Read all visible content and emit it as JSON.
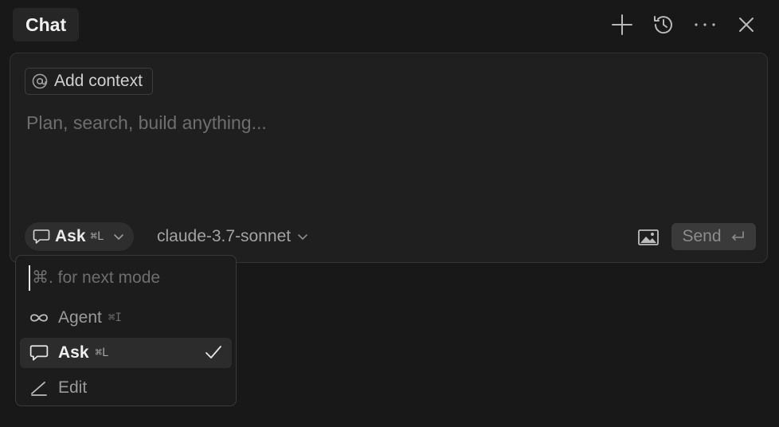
{
  "header": {
    "tab_label": "Chat",
    "actions": [
      {
        "name": "new-chat-button",
        "icon": "plus-icon"
      },
      {
        "name": "history-button",
        "icon": "history-icon"
      },
      {
        "name": "more-options-button",
        "icon": "more-horizontal-icon"
      },
      {
        "name": "close-button",
        "icon": "close-icon"
      }
    ]
  },
  "composer": {
    "add_context_label": "Add context",
    "prompt_placeholder": "Plan, search, build anything...",
    "mode": {
      "label": "Ask",
      "shortcut": "⌘L"
    },
    "model": "claude-3.7-sonnet",
    "send_label": "Send"
  },
  "mode_menu": {
    "search_placeholder": "⌘. for next mode",
    "items": [
      {
        "label": "Agent",
        "shortcut": "⌘I",
        "icon": "infinity-icon",
        "selected": false
      },
      {
        "label": "Ask",
        "shortcut": "⌘L",
        "icon": "chat-bubble-icon",
        "selected": true
      },
      {
        "label": "Edit",
        "shortcut": "",
        "icon": "pencil-icon",
        "selected": false
      }
    ]
  },
  "colors": {
    "background": "#181818",
    "panel": "#1f1f1f",
    "border": "#333333",
    "text_primary": "#eaeaea",
    "text_muted": "#6e6e6e"
  }
}
